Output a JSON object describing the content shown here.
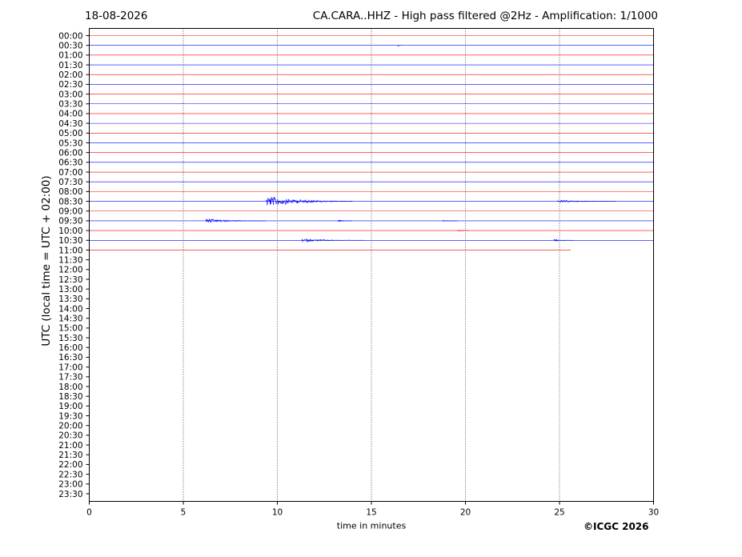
{
  "header": {
    "date": "18-08-2026",
    "title": "CA.CARA..HHZ - High pass filtered @2Hz - Amplification: 1/1000"
  },
  "footer": {
    "copyright": "©ICGC 2026"
  },
  "chart_data": {
    "type": "line",
    "xlabel": "time in minutes",
    "ylabel": "UTC (local time = UTC + 02:00)",
    "xlim": [
      0,
      30
    ],
    "x_ticks": [
      "0",
      "5",
      "10",
      "15",
      "20",
      "25",
      "30"
    ],
    "grid_x": true,
    "rows": [
      "00:00",
      "00:30",
      "01:00",
      "01:30",
      "02:00",
      "02:30",
      "03:00",
      "03:30",
      "04:00",
      "04:30",
      "05:00",
      "05:30",
      "06:00",
      "06:30",
      "07:00",
      "07:30",
      "08:00",
      "08:30",
      "09:00",
      "09:30",
      "10:00",
      "10:30",
      "11:00",
      "11:30",
      "12:00",
      "12:30",
      "13:00",
      "13:30",
      "14:00",
      "14:30",
      "15:00",
      "15:30",
      "16:00",
      "16:30",
      "17:00",
      "17:30",
      "18:00",
      "18:30",
      "19:00",
      "19:30",
      "20:00",
      "20:30",
      "21:00",
      "21:30",
      "22:00",
      "22:30",
      "23:00",
      "23:30"
    ],
    "trace_colors": [
      "#ff0000",
      "#0000ff"
    ],
    "data_end": {
      "row": "11:00",
      "minute": 25.6
    },
    "events": [
      {
        "row": "00:30",
        "start": 16.4,
        "end": 16.6,
        "amplitude": 1.2
      },
      {
        "row": "08:30",
        "start": 9.4,
        "end": 14.0,
        "amplitude": 7.0
      },
      {
        "row": "08:30",
        "start": 24.9,
        "end": 28.0,
        "amplitude": 1.6
      },
      {
        "row": "09:30",
        "start": 6.2,
        "end": 9.4,
        "amplitude": 2.8
      },
      {
        "row": "09:30",
        "start": 13.2,
        "end": 14.0,
        "amplitude": 1.6
      },
      {
        "row": "09:30",
        "start": 18.8,
        "end": 19.6,
        "amplitude": 0.8
      },
      {
        "row": "10:00",
        "start": 19.6,
        "end": 20.2,
        "amplitude": 0.8
      },
      {
        "row": "10:30",
        "start": 11.3,
        "end": 14.6,
        "amplitude": 2.2
      },
      {
        "row": "10:30",
        "start": 24.7,
        "end": 25.8,
        "amplitude": 1.2
      }
    ]
  },
  "colors": {
    "trace_red": "#ff0000",
    "trace_blue": "#0000ff",
    "axis": "#000000"
  }
}
